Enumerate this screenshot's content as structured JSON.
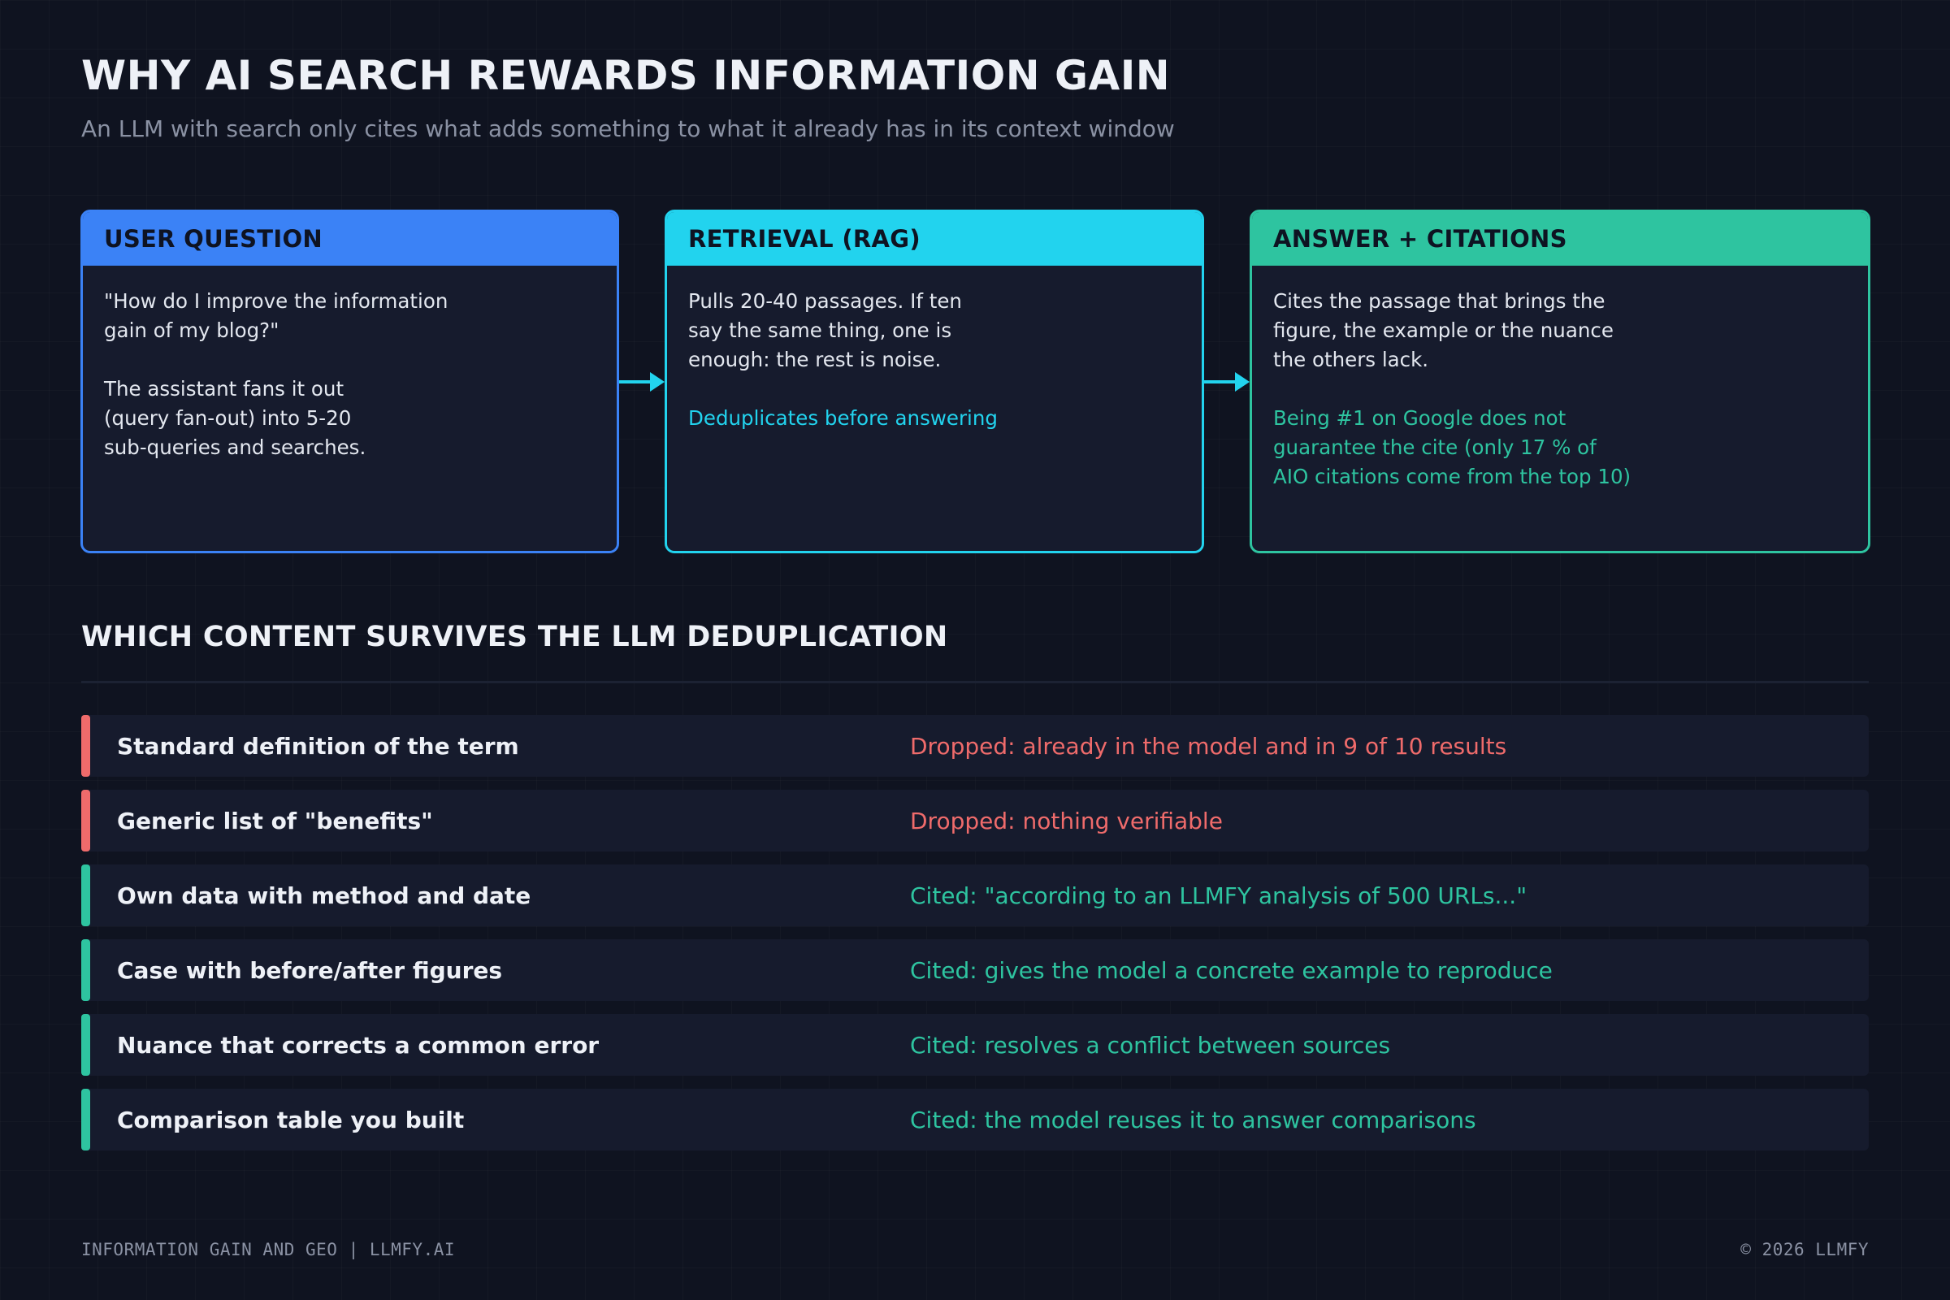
{
  "header": {
    "title": "WHY AI SEARCH REWARDS INFORMATION GAIN",
    "subtitle": "An LLM with search only cites what adds something to what it already has in its context window"
  },
  "flow": [
    {
      "heading": "USER QUESTION",
      "lines_a": [
        "\"How do I improve the information",
        "gain of my blog?\""
      ],
      "lines_b": [
        "The assistant fans it out",
        "(query fan-out) into 5-20",
        "sub-queries and searches."
      ],
      "color": "#3b82f6"
    },
    {
      "heading": "RETRIEVAL (RAG)",
      "lines_a": [
        "Pulls 20-40 passages. If ten",
        "say the same thing, one is",
        "enough: the rest is noise."
      ],
      "lines_b": [
        "Deduplicates before answering"
      ],
      "color": "#22d3ee"
    },
    {
      "heading": "ANSWER + CITATIONS",
      "lines_a": [
        "Cites the passage that brings the",
        "figure, the example or the nuance",
        "the others lack."
      ],
      "lines_b": [
        "Being #1 on Google does not",
        "guarantee the cite (only 17 % of",
        "AIO citations come from the top 10)"
      ],
      "color": "#2ec4a0"
    }
  ],
  "section": {
    "title": "WHICH CONTENT SURVIVES THE LLM DEDUPLICATION"
  },
  "rows": [
    {
      "label": "Standard definition of the term",
      "result": "Dropped: already in the model and in 9 of 10 results",
      "status": "dropped"
    },
    {
      "label": "Generic list of \"benefits\"",
      "result": "Dropped: nothing verifiable",
      "status": "dropped"
    },
    {
      "label": "Own data with method and date",
      "result": "Cited: \"according to an LLMFY analysis of 500 URLs...\"",
      "status": "cited"
    },
    {
      "label": "Case with before/after figures",
      "result": "Cited: gives the model a concrete example to reproduce",
      "status": "cited"
    },
    {
      "label": "Nuance that corrects a common error",
      "result": "Cited: resolves a conflict between sources",
      "status": "cited"
    },
    {
      "label": "Comparison table you built",
      "result": "Cited: the model reuses it to answer comparisons",
      "status": "cited"
    }
  ],
  "colors": {
    "dropped": "#ef6b6b",
    "cited": "#2ec4a0",
    "background": "#0f1320"
  },
  "footer": {
    "left": "INFORMATION GAIN AND GEO | LLMFY.AI",
    "right": "© 2026 LLMFY"
  }
}
